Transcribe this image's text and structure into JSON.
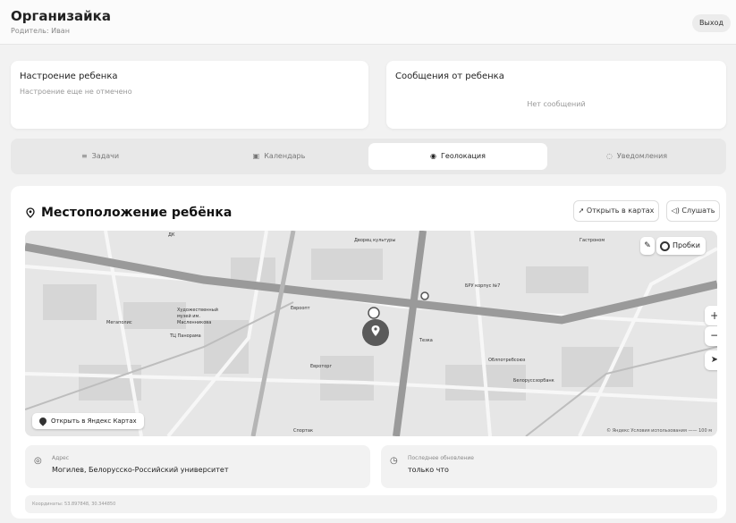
{
  "header": {
    "title": "Организайка",
    "subtitle": "Родитель: Иван",
    "logout_label": "Выход"
  },
  "mood": {
    "title": "Настроение ребенка",
    "text": "Настроение еще не отмечено"
  },
  "messages": {
    "title": "Сообщения от ребенка",
    "empty": "Нет сообщений"
  },
  "tabs": [
    {
      "label": "Задачи",
      "icon": "list-icon"
    },
    {
      "label": "Календарь",
      "icon": "calendar-icon"
    },
    {
      "label": "Геолокация",
      "icon": "pin-icon",
      "active": true
    },
    {
      "label": "Уведомления",
      "icon": "bell-icon"
    }
  ],
  "location": {
    "title": "Местоположение ребёнка",
    "open_maps_label": "Открыть в картах",
    "listen_label": "Слушать",
    "map": {
      "traffic_label": "Пробки",
      "open_yandex_label": "Открыть в Яндекс Картах",
      "copyright": "© Яндекс  Условия использования   —— 100 м",
      "labels": [
        "Тезка",
        "Дворец культуры",
        "ТЦ Панорама",
        "Художественный музей им. Масленникова",
        "БРУ корпус №7",
        "Мегаполис",
        "Евроопт",
        "Белоруссзорбанк",
        "Облпотребсоюз",
        "Евроторг",
        "Спортак"
      ]
    },
    "address": {
      "label": "Адрес",
      "value": "Могилев, Белорусско-Российский университет"
    },
    "updated": {
      "label": "Последнее обновление",
      "value": "только что"
    },
    "coordinates": "Координаты: 53.897848, 30.344850"
  }
}
